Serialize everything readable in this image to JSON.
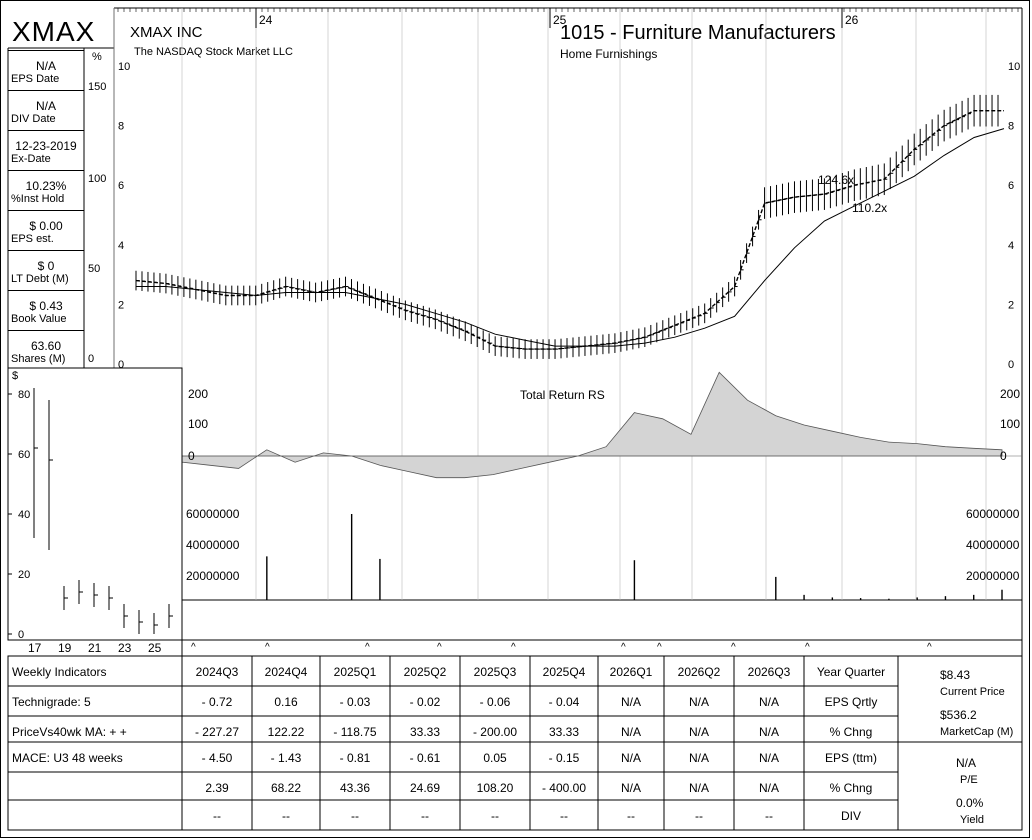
{
  "ticker": "XMAX",
  "company": "XMAX INC",
  "market": "The NASDAQ Stock Market LLC",
  "industry": "1015 - Furniture Manufacturers",
  "sub_industry": "Home Furnishings",
  "left_panel": [
    {
      "value": "N/A",
      "key": "EPS Date"
    },
    {
      "value": "N/A",
      "key": "DIV Date"
    },
    {
      "value": "12-23-2019",
      "key": "Ex-Date"
    },
    {
      "value": "10.23%",
      "key": "%Inst Hold"
    },
    {
      "value": "$ 0.00",
      "key": "EPS est."
    },
    {
      "value": "$ 0",
      "key": "LT Debt (M)"
    },
    {
      "value": "$ 0.43",
      "key": "Book Value"
    },
    {
      "value": "63.60",
      "key": "Shares (M)"
    }
  ],
  "pct_axis": {
    "unit": "%",
    "ticks": [
      "150",
      "100",
      "50",
      "0"
    ]
  },
  "price_axis": {
    "ticks": [
      "10",
      "8",
      "6",
      "4",
      "2",
      "0"
    ]
  },
  "year_labels": [
    "24",
    "25",
    "26"
  ],
  "rs_label": "Total Return RS",
  "rs_ticks": [
    "200",
    "100",
    "0"
  ],
  "volume_ticks": [
    "60000000",
    "40000000",
    "20000000"
  ],
  "annotations": [
    "124.6x",
    "110.2x"
  ],
  "inset": {
    "unit": "$",
    "y_ticks": [
      "80",
      "60",
      "40",
      "20",
      "0"
    ],
    "x_ticks": [
      "17",
      "19",
      "21",
      "23",
      "25"
    ]
  },
  "chart_data": [
    {
      "type": "line",
      "title": "1015 - Furniture Manufacturers",
      "x_range": [
        "2024-01",
        "2026-06"
      ],
      "ylim": [
        0,
        10
      ],
      "series": [
        {
          "values": [
            2.8,
            2.7,
            2.5,
            2.3,
            2.3,
            2.6,
            2.4,
            2.6,
            2.2,
            1.8,
            1.5,
            1.1,
            0.6,
            0.5,
            0.5,
            0.6,
            0.7,
            0.9,
            1.3,
            1.7,
            2.6,
            5.4,
            5.6,
            5.7,
            6.0,
            6.2,
            7.2,
            8.0,
            8.5,
            8.5
          ]
        },
        {
          "values": [
            2.6,
            2.6,
            2.5,
            2.4,
            2.3,
            2.4,
            2.4,
            2.4,
            2.2,
            2.0,
            1.7,
            1.4,
            1.0,
            0.8,
            0.6,
            0.6,
            0.6,
            0.7,
            0.9,
            1.2,
            1.6,
            2.8,
            3.9,
            4.8,
            5.3,
            5.8,
            6.3,
            7.0,
            7.6,
            7.9
          ]
        }
      ]
    },
    {
      "type": "area",
      "title": "Total Return RS",
      "ylim": [
        -100,
        300
      ],
      "values": [
        -20,
        -30,
        -40,
        20,
        -20,
        10,
        0,
        -30,
        -50,
        -70,
        -70,
        -60,
        -40,
        -20,
        0,
        30,
        140,
        120,
        70,
        270,
        180,
        130,
        100,
        80,
        60,
        45,
        40,
        30,
        25,
        20
      ]
    },
    {
      "type": "bar",
      "title": "Volume",
      "ylim": [
        0,
        70000000
      ],
      "values": [
        0,
        0,
        0,
        34000000,
        0,
        0,
        67000000,
        32000000,
        0,
        0,
        0,
        0,
        0,
        0,
        0,
        0,
        31000000,
        0,
        0,
        0,
        0,
        18000000,
        4000000,
        2000000,
        1500000,
        1000000,
        2000000,
        3000000,
        4000000,
        8000000
      ]
    },
    {
      "type": "line",
      "title": "",
      "x": [
        "17",
        "18",
        "19",
        "20",
        "21",
        "22",
        "23",
        "24",
        "25",
        "26"
      ],
      "ylim": [
        0,
        90
      ],
      "values": [
        62,
        58,
        12,
        14,
        13,
        12,
        6,
        4,
        3,
        6
      ]
    }
  ],
  "quarter_row": [
    "2024Q3",
    "2024Q4",
    "2025Q1",
    "2025Q2",
    "2025Q3",
    "2025Q4",
    "2026Q1",
    "2026Q2",
    "2026Q3",
    "Year Quarter"
  ],
  "rows": [
    {
      "label": "Weekly Indicators",
      "values": [
        "2024Q3",
        "2024Q4",
        "2025Q1",
        "2025Q2",
        "2025Q3",
        "2025Q4",
        "2026Q1",
        "2026Q2",
        "2026Q3",
        "Year Quarter"
      ]
    },
    {
      "label": "Technigrade: 5",
      "values": [
        "- 0.72",
        "0.16",
        "- 0.03",
        "- 0.02",
        "- 0.06",
        "- 0.04",
        "N/A",
        "N/A",
        "N/A",
        "EPS Qrtly"
      ]
    },
    {
      "label": "PriceVs40wk MA:  + +",
      "values": [
        "- 227.27",
        "122.22",
        "- 118.75",
        "33.33",
        "- 200.00",
        "33.33",
        "N/A",
        "N/A",
        "N/A",
        "% Chng"
      ]
    },
    {
      "label": "MACE: U3  48 weeks",
      "values": [
        "- 4.50",
        "- 1.43",
        "- 0.81",
        "- 0.61",
        "0.05",
        "- 0.15",
        "N/A",
        "N/A",
        "N/A",
        "EPS (ttm)"
      ]
    },
    {
      "label": "",
      "values": [
        "2.39",
        "68.22",
        "43.36",
        "24.69",
        "108.20",
        "- 400.00",
        "N/A",
        "N/A",
        "N/A",
        "% Chng"
      ]
    },
    {
      "label": "",
      "values": [
        "--",
        "--",
        "--",
        "--",
        "--",
        "--",
        "--",
        "--",
        "--",
        "DIV"
      ]
    }
  ],
  "right_stats": [
    {
      "value": "$8.43",
      "key": "Current Price"
    },
    {
      "value": "$536.2",
      "key": "MarketCap (M)"
    },
    {
      "value": "N/A",
      "key": "P/E"
    },
    {
      "value": "0.0%",
      "key": "Yield"
    }
  ]
}
